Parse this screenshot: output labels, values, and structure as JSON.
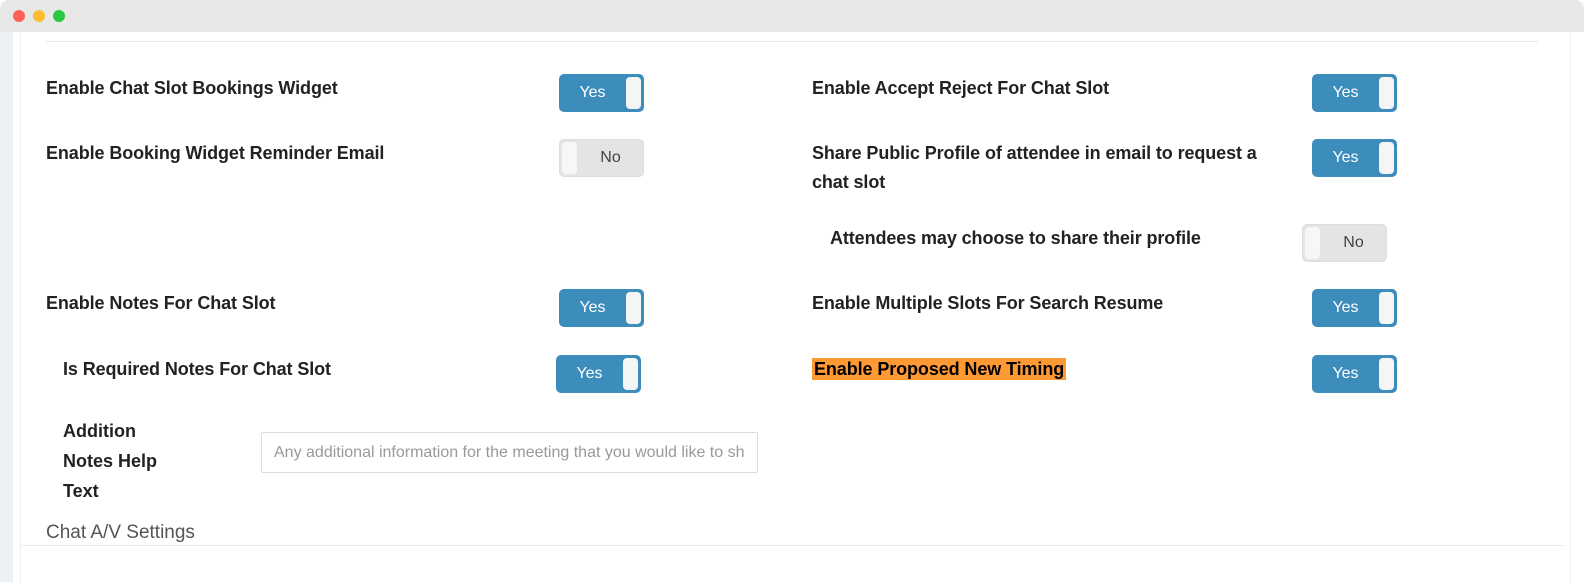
{
  "window": {
    "traffic_lights": [
      "close",
      "minimize",
      "zoom"
    ]
  },
  "settings": {
    "left_column": [
      {
        "label": "Enable Chat Slot Bookings Widget",
        "toggle": {
          "state": "on",
          "value": "Yes"
        }
      },
      {
        "label": "Enable Booking Widget Reminder Email",
        "toggle": {
          "state": "off",
          "value": "No"
        }
      },
      {
        "label": "Enable Notes For Chat Slot",
        "toggle": {
          "state": "on",
          "value": "Yes"
        }
      },
      {
        "label": "Is Required Notes For Chat Slot",
        "toggle": {
          "state": "on",
          "value": "Yes"
        }
      }
    ],
    "right_column": [
      {
        "label": "Enable Accept Reject For Chat Slot",
        "toggle": {
          "state": "on",
          "value": "Yes"
        }
      },
      {
        "label": "Share Public Profile of attendee in email to request a chat slot",
        "toggle": {
          "state": "on",
          "value": "Yes"
        }
      },
      {
        "label": "Attendees may choose to share their profile",
        "toggle": {
          "state": "off",
          "value": "No"
        }
      },
      {
        "label": "Enable Multiple Slots For Search Resume",
        "toggle": {
          "state": "on",
          "value": "Yes"
        }
      },
      {
        "label": "Enable Proposed New Timing",
        "highlighted": true,
        "highlight_color": "#ff9933",
        "toggle": {
          "state": "on",
          "value": "Yes"
        }
      }
    ]
  },
  "notes_help": {
    "label_line1": "Addition",
    "label_line2": "Notes Help",
    "label_line3": "Text",
    "input_value": "",
    "input_placeholder": "Any additional information for the meeting that you would like to share"
  },
  "section": {
    "chat_av_settings": "Chat A/V Settings"
  },
  "colors": {
    "toggle_on": "#3c8dbc",
    "toggle_off": "#e4e4e4",
    "highlight": "#ff9933",
    "label_text": "#222222"
  }
}
